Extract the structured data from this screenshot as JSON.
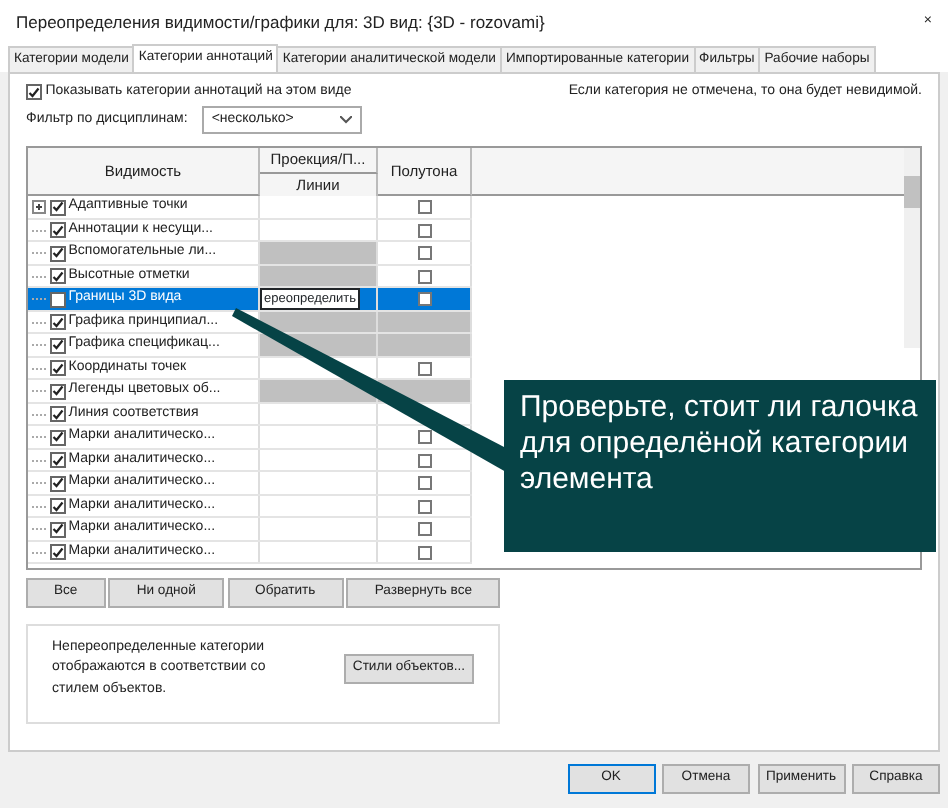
{
  "window": {
    "title": "Переопределения видимости/графики для: 3D вид: {3D - rozovami}",
    "close": "×"
  },
  "tabs": [
    {
      "label": "Категории модели",
      "selected": false
    },
    {
      "label": "Категории аннотаций",
      "selected": true
    },
    {
      "label": "Категории аналитической модели",
      "selected": false
    },
    {
      "label": "Импортированные категории",
      "selected": false
    },
    {
      "label": "Фильтры",
      "selected": false
    },
    {
      "label": "Рабочие наборы",
      "selected": false
    }
  ],
  "show_categories": {
    "label": "Показывать категории аннотаций на этом виде",
    "checked": true
  },
  "hint": "Если категория не отмечена, то она будет невидимой.",
  "discipline_filter": {
    "label": "Фильтр по дисциплинам:",
    "value": "<несколько>"
  },
  "table": {
    "columns": {
      "visibility": "Видимость",
      "projection": "Проекция/П...",
      "lines": "Линии",
      "halftone": "Полутона"
    },
    "rows": [
      {
        "name": "Адаптивные точки",
        "checked": true,
        "expandable": true,
        "selected": false,
        "kind": "normal",
        "halftone": false
      },
      {
        "name": "Аннотации к несущи...",
        "checked": true,
        "expandable": false,
        "selected": false,
        "kind": "normal",
        "halftone": false
      },
      {
        "name": "Вспомогательные ли...",
        "checked": true,
        "expandable": false,
        "selected": false,
        "kind": "grey-projection",
        "halftone": false
      },
      {
        "name": "Высотные отметки",
        "checked": true,
        "expandable": false,
        "selected": false,
        "kind": "grey-projection",
        "halftone": false
      },
      {
        "name": "Границы 3D вида",
        "checked": false,
        "expandable": false,
        "selected": true,
        "kind": "override",
        "projection_text": "ереопределить",
        "halftone": false
      },
      {
        "name": "Графика принципиал...",
        "checked": true,
        "expandable": false,
        "selected": false,
        "kind": "grey-both"
      },
      {
        "name": "Графика спецификац...",
        "checked": true,
        "expandable": false,
        "selected": false,
        "kind": "grey-both"
      },
      {
        "name": "Координаты точек",
        "checked": true,
        "expandable": false,
        "selected": false,
        "kind": "normal",
        "halftone": false
      },
      {
        "name": "Легенды цветовых об...",
        "checked": true,
        "expandable": false,
        "selected": false,
        "kind": "grey-both"
      },
      {
        "name": "Линия соответствия",
        "checked": true,
        "expandable": false,
        "selected": false,
        "kind": "normal"
      },
      {
        "name": "Марки аналитическо...",
        "checked": true,
        "expandable": false,
        "selected": false,
        "kind": "normal",
        "halftone": false
      },
      {
        "name": "Марки аналитическо...",
        "checked": true,
        "expandable": false,
        "selected": false,
        "kind": "normal",
        "halftone": false
      },
      {
        "name": "Марки аналитическо...",
        "checked": true,
        "expandable": false,
        "selected": false,
        "kind": "normal",
        "halftone": false
      },
      {
        "name": "Марки аналитическо...",
        "checked": true,
        "expandable": false,
        "selected": false,
        "kind": "normal",
        "halftone": false
      },
      {
        "name": "Марки аналитическо...",
        "checked": true,
        "expandable": false,
        "selected": false,
        "kind": "normal",
        "halftone": false
      },
      {
        "name": "Марки аналитическо...",
        "checked": true,
        "expandable": false,
        "selected": false,
        "kind": "normal",
        "halftone": false
      }
    ]
  },
  "table_buttons": [
    "Все",
    "Ни одной",
    "Обратить",
    "Развернуть все"
  ],
  "note": {
    "text": "Непереопределенные категории отображаются в соответствии со стилем объектов.",
    "button": "Стили объектов..."
  },
  "callout": "Проверьте, стоит ли галочка для определёной категории элемента",
  "dialog_buttons": [
    {
      "label": "OK",
      "default": true
    },
    {
      "label": "Отмена",
      "default": false
    },
    {
      "label": "Применить",
      "default": false
    },
    {
      "label": "Справка",
      "default": false
    }
  ]
}
